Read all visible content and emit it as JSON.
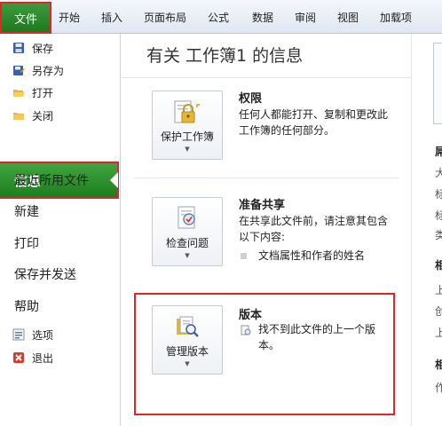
{
  "tabs": {
    "file": "文件",
    "items": [
      "开始",
      "插入",
      "页面布局",
      "公式",
      "数据",
      "审阅",
      "视图",
      "加载项"
    ]
  },
  "menu": {
    "save": "保存",
    "save_as": "另存为",
    "open": "打开",
    "close": "关闭",
    "info": "信息",
    "recent": "最近所用文件",
    "new": "新建",
    "print": "打印",
    "save_send": "保存并发送",
    "help": "帮助",
    "options": "选项",
    "exit": "退出"
  },
  "main": {
    "title": "有关 工作簿1 的信息",
    "permissions": {
      "button": "保护工作簿",
      "heading": "权限",
      "text": "任何人都能打开、复制和更改此工作簿的任何部分。"
    },
    "prepare": {
      "button": "检查问题",
      "heading": "准备共享",
      "text": "在共享此文件前，请注意其包含以下内容:",
      "bullet": "文档属性和作者的姓名"
    },
    "versions": {
      "button": "管理版本",
      "heading": "版本",
      "text": "找不到此文件的上一个版本。"
    }
  },
  "rightpane": {
    "chars": [
      "屌",
      "大",
      "标",
      "标",
      "类",
      "相",
      "上",
      "创",
      "上",
      "相",
      "作"
    ]
  },
  "colors": {
    "file_green": "#1f7a1f",
    "highlight_red": "#e0262b"
  }
}
